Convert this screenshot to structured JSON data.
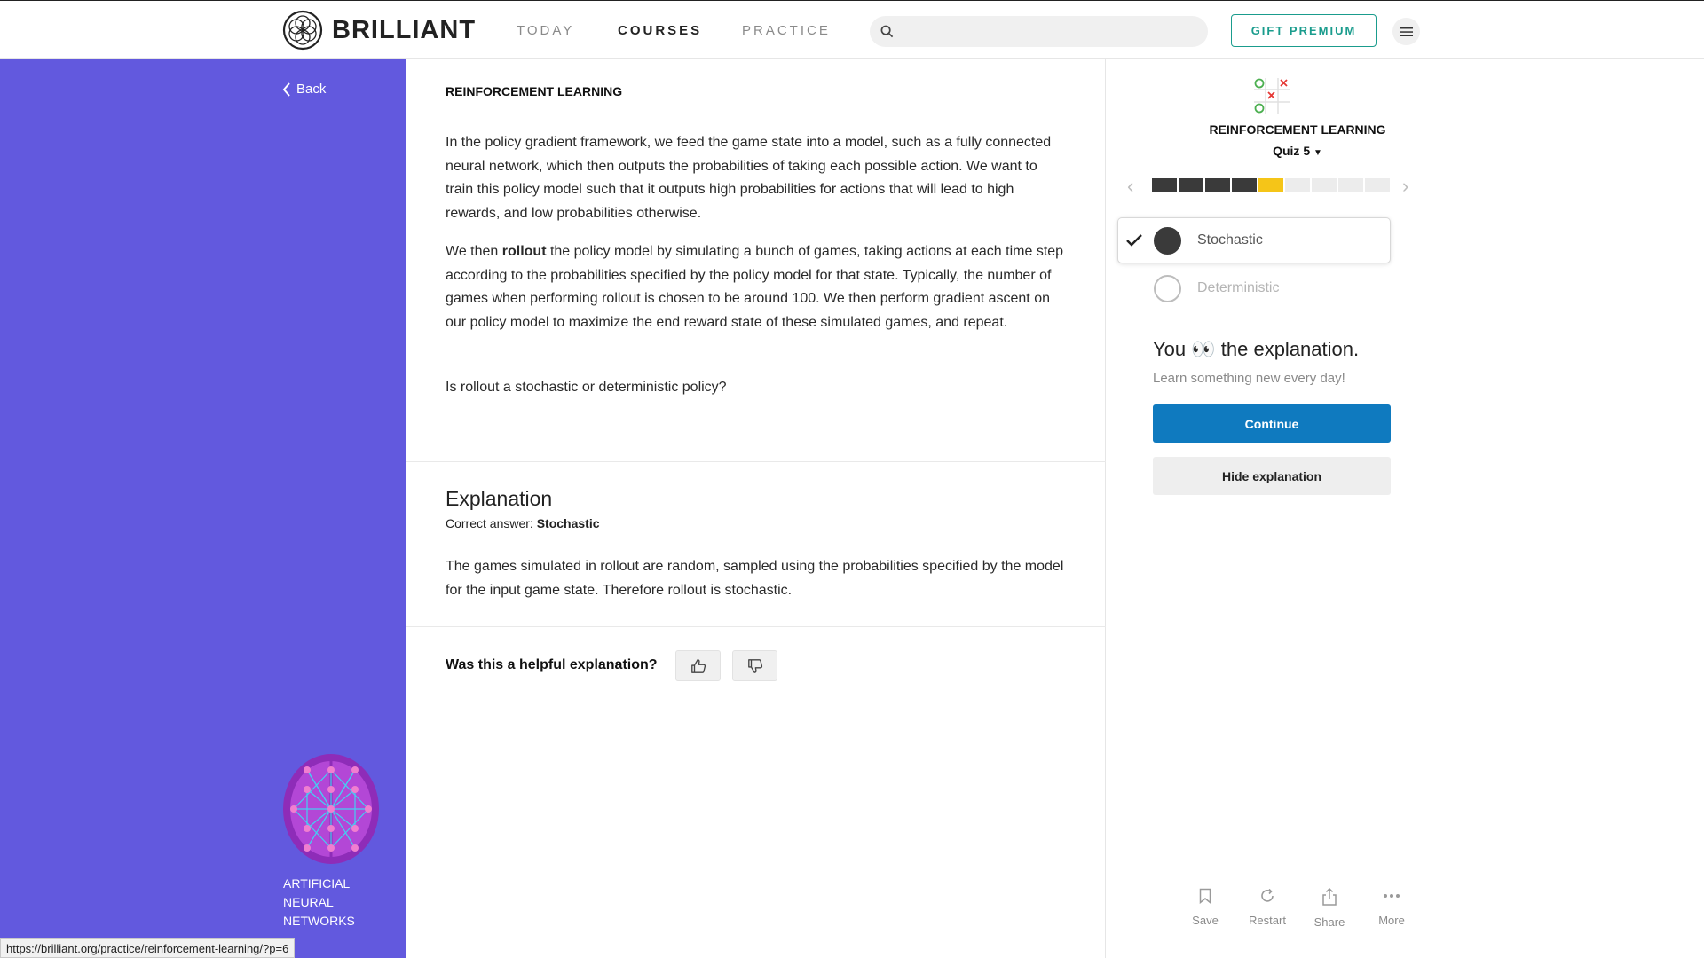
{
  "header": {
    "logo_text": "BRILLIANT",
    "nav": [
      "TODAY",
      "COURSES",
      "PRACTICE"
    ],
    "active_nav": "COURSES",
    "search_placeholder": "",
    "gift_label": "GIFT PREMIUM"
  },
  "sidebar": {
    "back_label": "Back",
    "course_name": "ARTIFICIAL NEURAL NETWORKS",
    "background_color": "#6259de"
  },
  "problem": {
    "section": "REINFORCEMENT LEARNING",
    "p1": "In the policy gradient framework, we feed the game state into a model, such as a fully connected neural network, which then outputs the probabilities of taking each possible action. We want to train this policy model such that it outputs high probabilities for actions that will lead to high rewards, and low probabilities otherwise.",
    "p2_before": "We then ",
    "p2_bold": "rollout",
    "p2_after": " the policy model by simulating a bunch of games, taking actions at each time step according to the probabilities specified by the policy model for that state. Typically, the number of games when performing rollout is chosen to be around 100. We then perform gradient ascent on our policy model to maximize the end reward state of these simulated games, and repeat.",
    "question": "Is rollout a stochastic or deterministic policy?"
  },
  "explanation": {
    "title": "Explanation",
    "correct_prefix": "Correct answer: ",
    "correct_answer": "Stochastic",
    "text": "The games simulated in rollout are random, sampled using the probabilities specified by the model for the input game state. Therefore rollout is stochastic.",
    "helpful_prompt": "Was this a helpful explanation?"
  },
  "quiz_panel": {
    "course": "REINFORCEMENT LEARNING",
    "quiz_label": "Quiz 5",
    "progress": {
      "total": 9,
      "completed": 4,
      "current": 5
    },
    "options": [
      {
        "label": "Stochastic",
        "selected": true
      },
      {
        "label": "Deterministic",
        "selected": false
      }
    ],
    "result_before": "You ",
    "result_emoji": "👀",
    "result_after": " the explanation.",
    "tagline": "Learn something new every day!",
    "continue_label": "Continue",
    "hide_label": "Hide explanation",
    "tools": [
      "Save",
      "Restart",
      "Share",
      "More"
    ],
    "accent_blue": "#0f7abf",
    "progress_current_color": "#f5c518"
  },
  "status_bar": {
    "url": "https://brilliant.org/practice/reinforcement-learning/?p=6"
  }
}
